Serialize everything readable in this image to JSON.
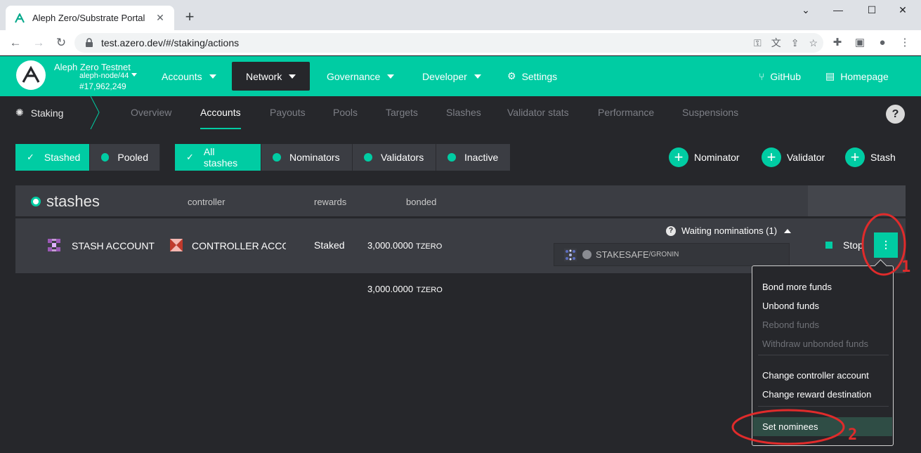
{
  "browser": {
    "tab_title": "Aleph Zero/Substrate Portal",
    "url": "test.azero.dev/#/staking/actions"
  },
  "header": {
    "chain_name": "Aleph Zero Testnet",
    "node": "aleph-node/44",
    "block": "#17,962,249",
    "menu": [
      {
        "label": "Accounts"
      },
      {
        "label": "Network"
      },
      {
        "label": "Governance"
      },
      {
        "label": "Developer"
      },
      {
        "label": "Settings"
      },
      {
        "label": "GitHub"
      },
      {
        "label": "Homepage"
      }
    ],
    "accent": "#00cca3"
  },
  "subnav": {
    "title": "Staking",
    "tabs": [
      "Overview",
      "Accounts",
      "Payouts",
      "Pools",
      "Targets",
      "Slashes",
      "Validator stats",
      "Performance",
      "Suspensions"
    ],
    "active_tab": "Accounts",
    "help": "?"
  },
  "filters": {
    "group1": [
      "Stashed",
      "Pooled"
    ],
    "group2": [
      "All stashes",
      "Nominators",
      "Validators",
      "Inactive"
    ]
  },
  "actions": [
    "Nominator",
    "Validator",
    "Stash"
  ],
  "table": {
    "title": "stashes",
    "headers": [
      "controller",
      "rewards",
      "bonded"
    ],
    "row": {
      "stash": "STASH ACCOUNT",
      "controller": "CONTROLLER ACCOU",
      "rewards": "Staked",
      "bonded_value": "3,000.0000",
      "bonded_unit": "TZERO",
      "waiting": "Waiting nominations (1)",
      "nominee_name": "STAKESAFE",
      "nominee_sub": "/GRONIN",
      "stop": "Stop"
    },
    "total_value": "3,000.0000",
    "total_unit": "TZERO"
  },
  "dropdown": {
    "items": [
      {
        "label": "Bond more funds",
        "disabled": false
      },
      {
        "label": "Unbond funds",
        "disabled": false
      },
      {
        "label": "Rebond funds",
        "disabled": true
      },
      {
        "label": "Withdraw unbonded funds",
        "disabled": true
      },
      {
        "label": "Change controller account",
        "disabled": false
      },
      {
        "label": "Change reward destination",
        "disabled": false
      },
      {
        "label": "Set nominees",
        "disabled": false
      }
    ]
  },
  "annotations": {
    "marker1": "1",
    "marker2": "2",
    "color": "#e02b2b"
  }
}
